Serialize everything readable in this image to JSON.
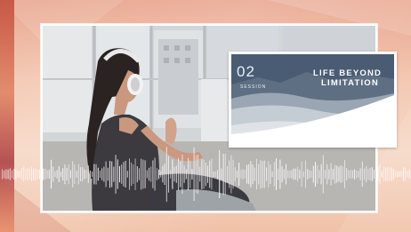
{
  "session_card": {
    "number": "02",
    "label": "SESSION",
    "title_line1": "LIFE BEYOND",
    "title_line2": "LIMITATION"
  },
  "colors": {
    "background_warm": "#f3c9b3",
    "accent_red": "#c24a3a",
    "card_blue": "#3d4f66",
    "white": "#ffffff"
  }
}
